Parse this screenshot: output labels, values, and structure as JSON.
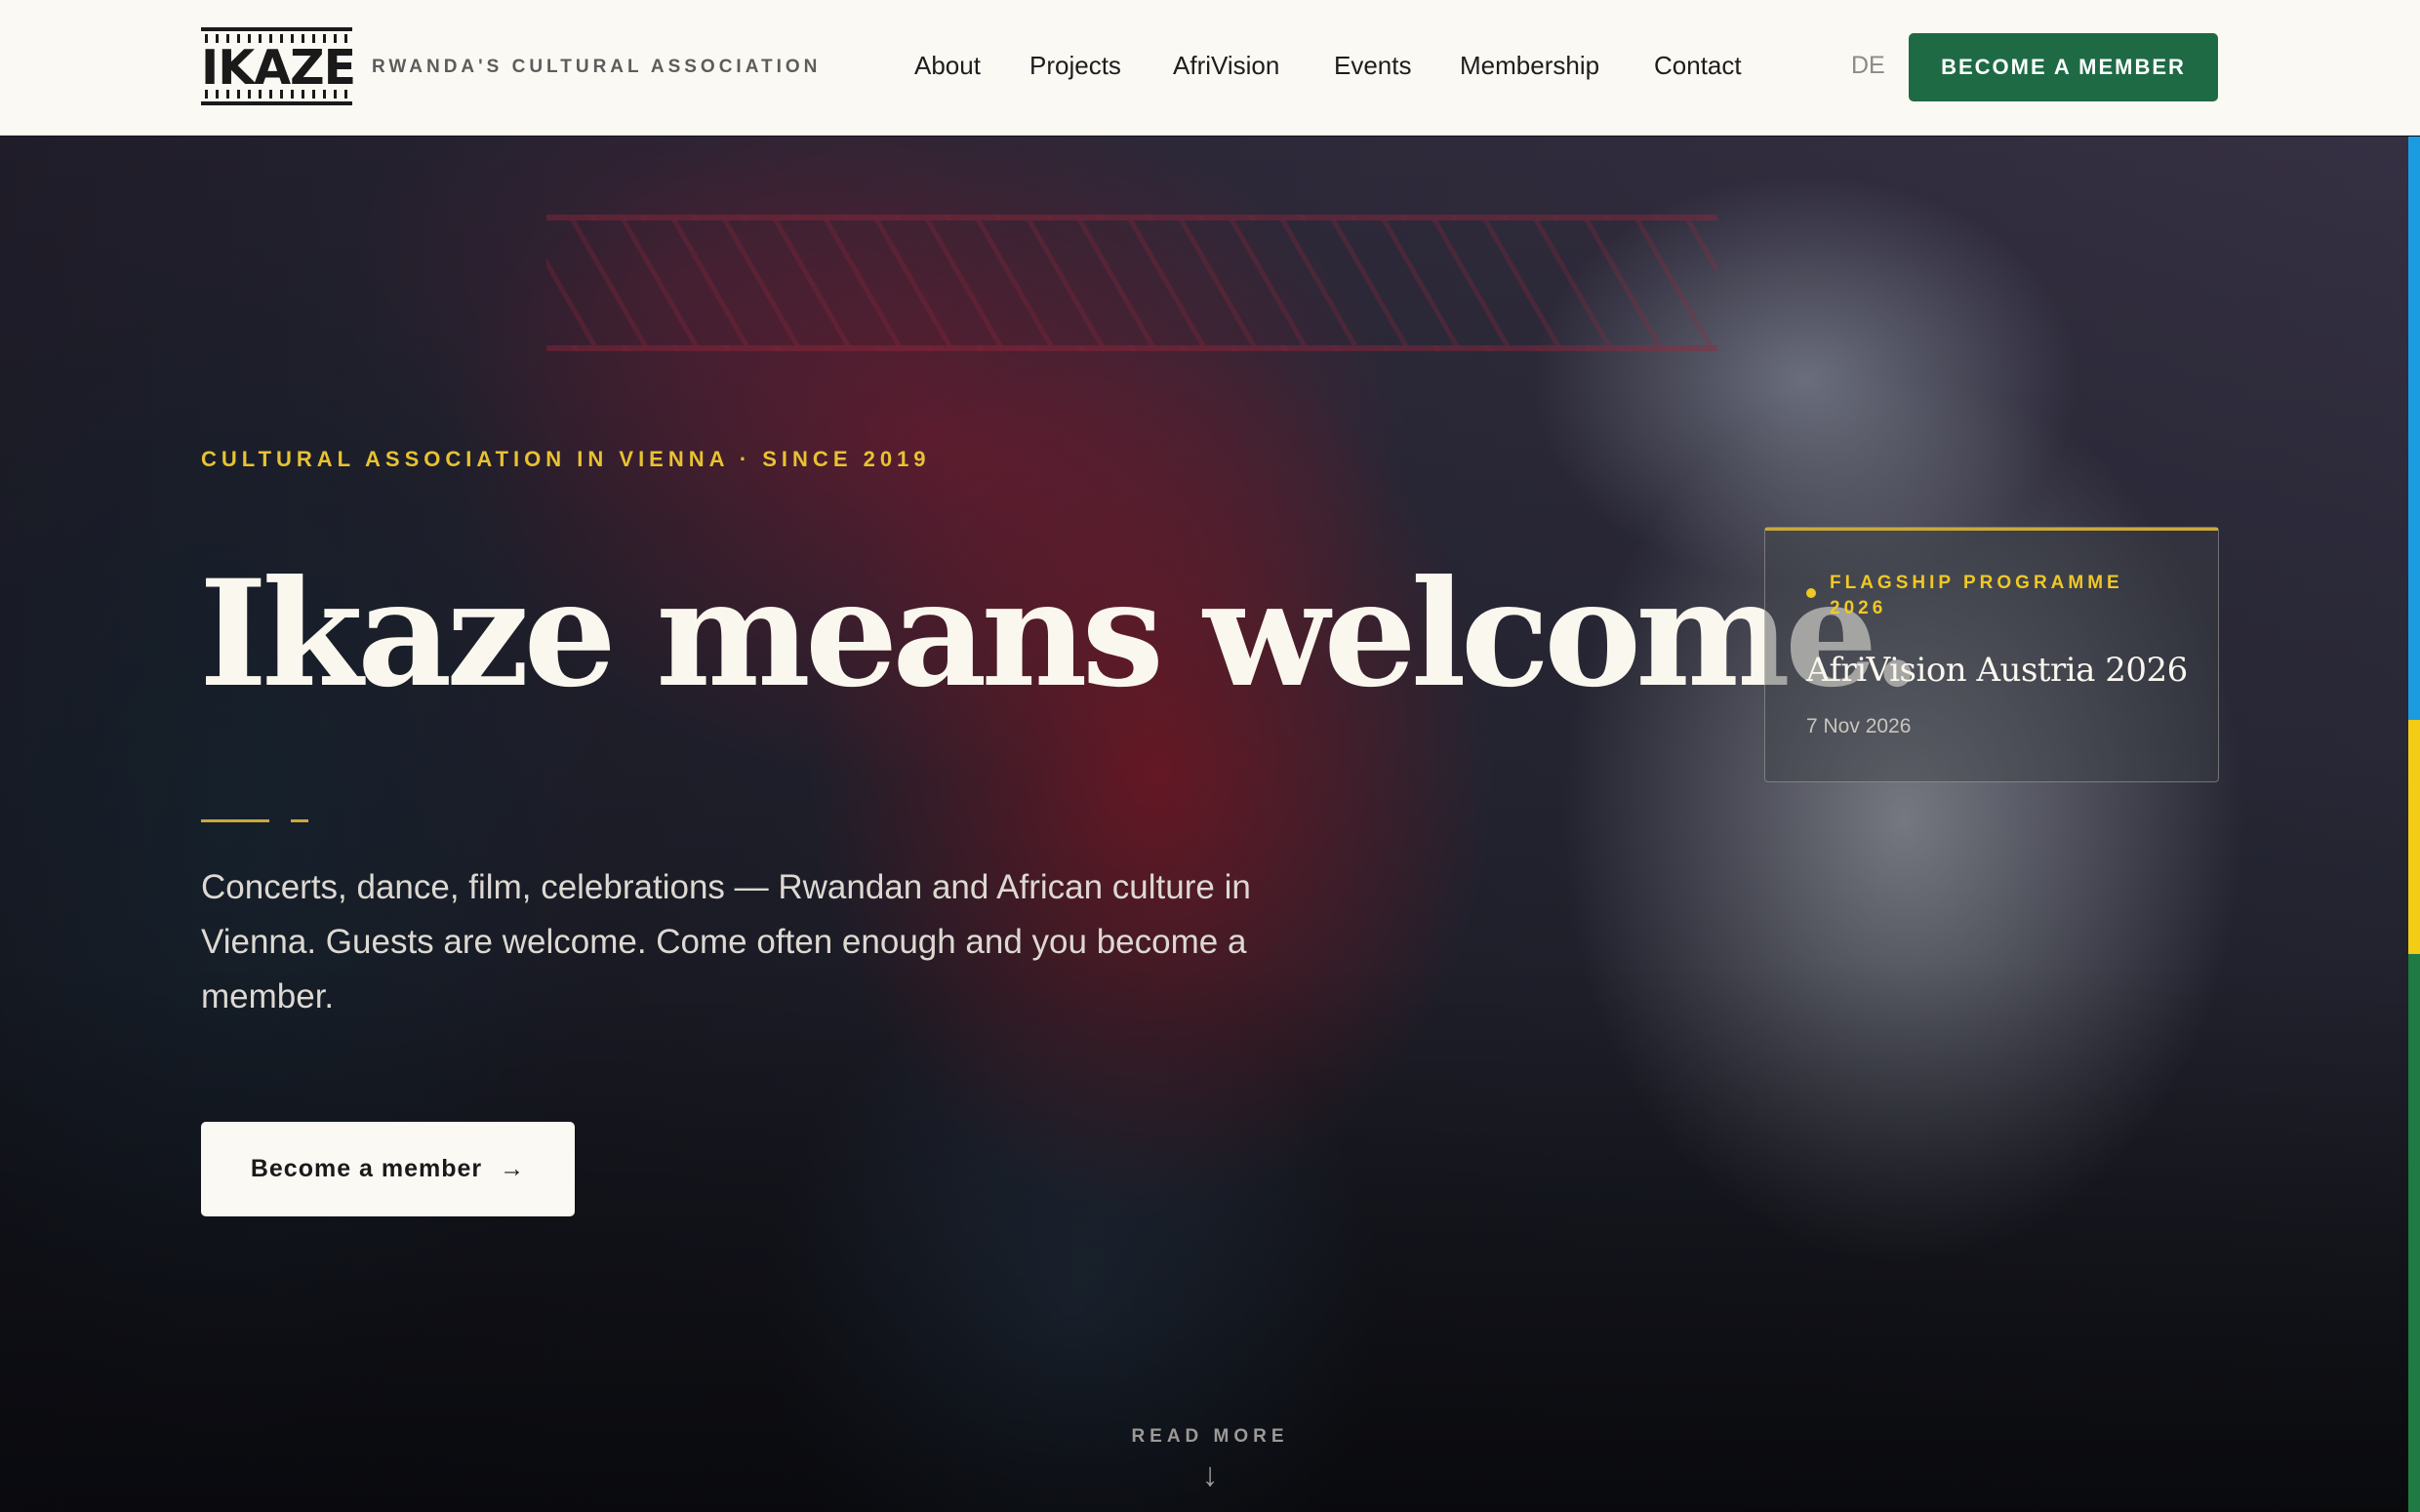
{
  "header": {
    "logo_text": "IKAZE",
    "tagline": "RWANDA'S CULTURAL ASSOCIATION",
    "nav": [
      {
        "label": "About"
      },
      {
        "label": "Projects"
      },
      {
        "label": "AfriVision"
      },
      {
        "label": "Events"
      },
      {
        "label": "Membership"
      },
      {
        "label": "Contact"
      }
    ],
    "language": "DE",
    "cta_label": "BECOME A MEMBER"
  },
  "hero": {
    "eyebrow": "CULTURAL ASSOCIATION IN VIENNA · SINCE 2019",
    "headline": "Ikaze means welcome.",
    "lede": "Concerts, dance, film, celebrations — Rwandan and African culture in Vienna. Guests are welcome. Come often enough and you become a member.",
    "cta_label": "Become a member",
    "cta_arrow": "→",
    "read_more": "READ MORE",
    "read_more_arrow": "↓"
  },
  "feature_card": {
    "eyebrow": "FLAGSHIP PROGRAMME 2026",
    "title": "AfriVision Austria 2026",
    "date": "7 Nov 2026"
  },
  "colors": {
    "brand_green": "#1e6a45",
    "accent_gold": "#e8c232",
    "header_bg": "#fbf9f3",
    "flag_blue": "#1b9be0",
    "flag_yellow": "#f3cc16",
    "flag_green": "#1f7a43"
  }
}
